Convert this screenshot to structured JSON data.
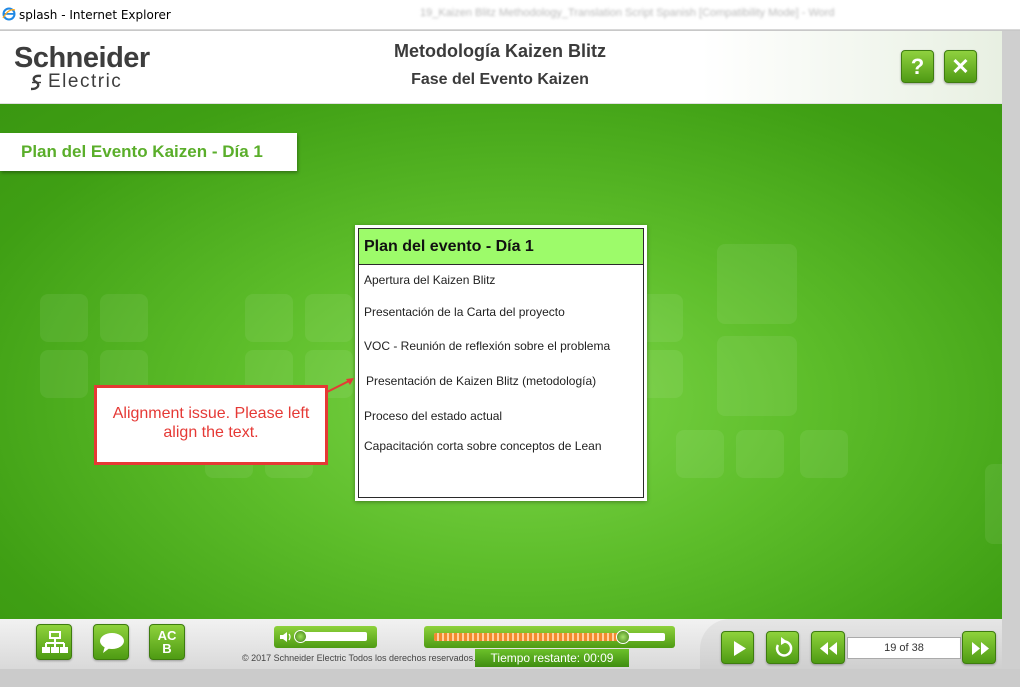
{
  "window": {
    "title": "splash - Internet Explorer",
    "background_title": "19_Kaizen Blitz Methodology_Translation Script Spanish [Compatibility Mode] - Word"
  },
  "header": {
    "logo_top": "Schneider",
    "logo_bottom": "Electric",
    "course_title": "Metodología Kaizen Blitz",
    "course_subtitle": "Fase del Evento Kaizen",
    "help_label": "?",
    "close_label": "✕"
  },
  "slide": {
    "section_title": "Plan del Evento Kaizen - Día 1",
    "panel": {
      "title": "Plan del evento - Día 1",
      "items": [
        "Apertura del Kaizen Blitz",
        "Presentación de la Carta del proyecto",
        "VOC - Reunión de reflexión sobre el problema",
        "Presentación de Kaizen Blitz (metodología)",
        "Proceso del estado actual",
        "Capacitación corta sobre conceptos de Lean"
      ]
    },
    "callout": "Alignment issue. Please left align the text."
  },
  "footer": {
    "menu_icon": "sitemap-icon",
    "chat_icon": "speech-bubble-icon",
    "glossary_label_top": "AC",
    "glossary_label_bottom": "B",
    "volume_level": 0.03,
    "progress": 0.82,
    "copyright": "© 2017 Schneider Electric Todos los derechos reservados.",
    "time_remaining": "Tiempo restante:  00:09",
    "page_indicator": "19 of 38"
  },
  "colors": {
    "brand_green": "#5aae2a",
    "panel_header": "#9dfb6a",
    "callout_red": "#e53935",
    "progress_orange": "#f28a2e"
  }
}
